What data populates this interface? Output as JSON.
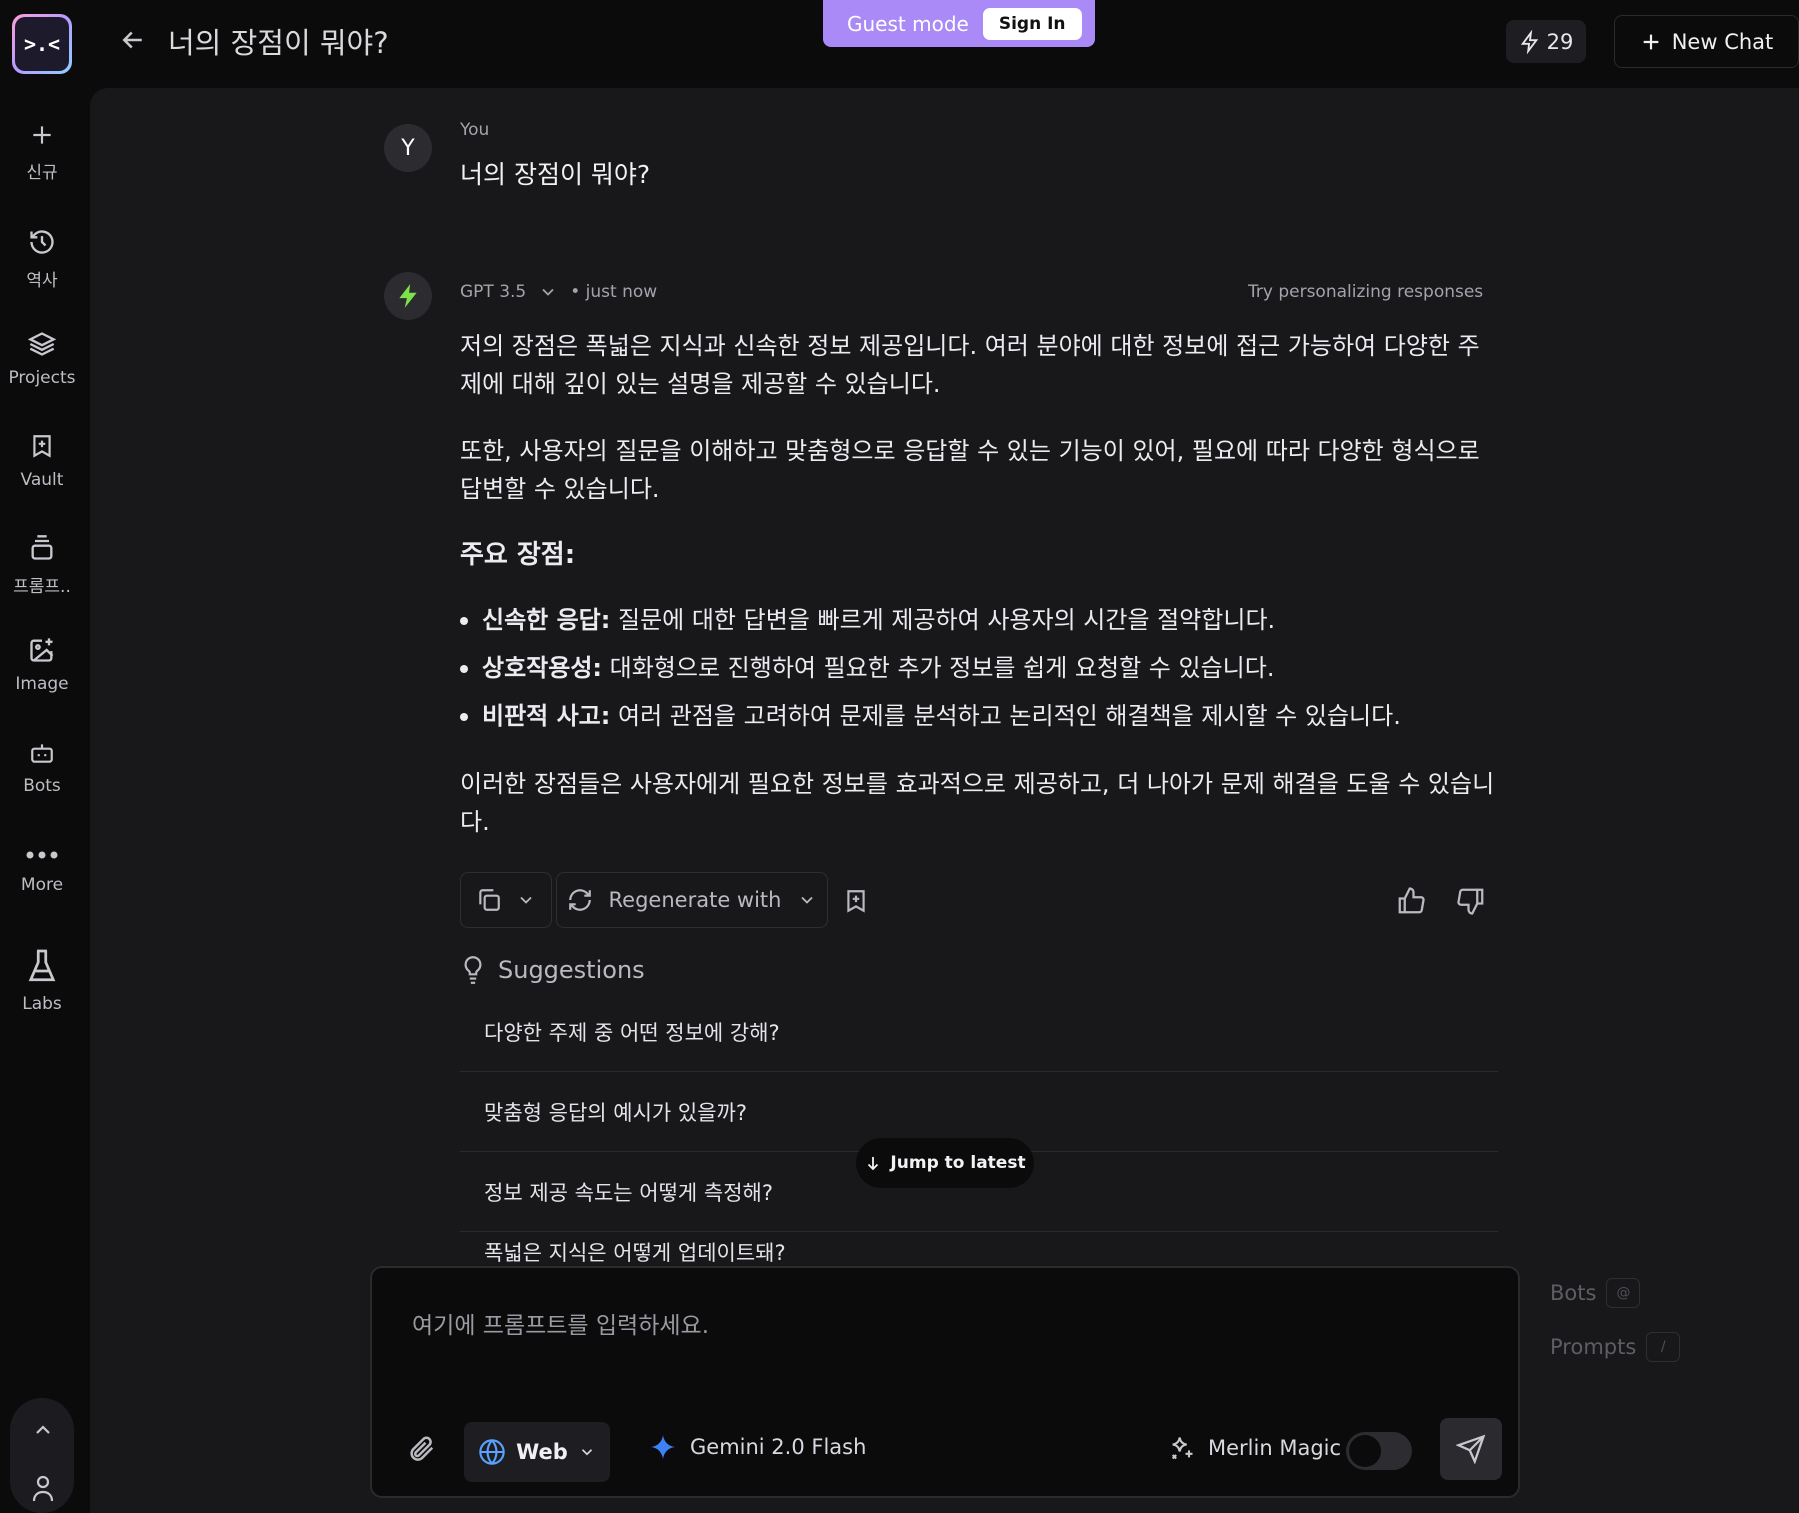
{
  "header": {
    "title": "너의 장점이 뭐야?",
    "guest_label": "Guest mode",
    "sign_in_label": "Sign In",
    "credits": "29",
    "new_chat_label": "New Chat"
  },
  "sidebar": {
    "logo_text": ">.<",
    "items": [
      {
        "label": "신규",
        "icon": "plus-icon"
      },
      {
        "label": "역사",
        "icon": "history-icon"
      },
      {
        "label": "Projects",
        "icon": "layers-icon"
      },
      {
        "label": "Vault",
        "icon": "vault-icon"
      },
      {
        "label": "프롬프..",
        "icon": "prompts-icon"
      },
      {
        "label": "Image",
        "icon": "image-plus-icon"
      },
      {
        "label": "Bots",
        "icon": "bot-icon"
      },
      {
        "label": "More",
        "icon": "more-icon"
      },
      {
        "label": "Labs",
        "icon": "flask-icon"
      }
    ]
  },
  "conversation": {
    "user": {
      "avatar_initial": "Y",
      "name": "You",
      "message": "너의 장점이 뭐야?"
    },
    "assistant": {
      "model": "GPT 3.5",
      "time": "• just now",
      "personalize": "Try personalizing responses",
      "paragraphs": [
        "저의 장점은 폭넓은 지식과 신속한 정보 제공입니다. 여러 분야에 대한 정보에 접근 가능하여 다양한 주제에 대해 깊이 있는 설명을 제공할 수 있습니다.",
        "또한, 사용자의 질문을 이해하고 맞춤형으로 응답할 수 있는 기능이 있어, 필요에 따라 다양한 형식으로 답변할 수 있습니다."
      ],
      "heading": "주요 장점:",
      "bullets": [
        {
          "term": "신속한 응답:",
          "text": " 질문에 대한 답변을 빠르게 제공하여 사용자의 시간을 절약합니다."
        },
        {
          "term": "상호작용성:",
          "text": " 대화형으로 진행하여 필요한 추가 정보를 쉽게 요청할 수 있습니다."
        },
        {
          "term": "비판적 사고:",
          "text": " 여러 관점을 고려하여 문제를 분석하고 논리적인 해결책을 제시할 수 있습니다."
        }
      ],
      "closing": "이러한 장점들은 사용자에게 필요한 정보를 효과적으로 제공하고, 더 나아가 문제 해결을 도울 수 있습니다."
    },
    "actions": {
      "regenerate_label": "Regenerate with"
    },
    "suggestions": {
      "title": "Suggestions",
      "items": [
        "다양한 주제 중 어떤 정보에 강해?",
        "맞춤형 응답의 예시가 있을까?",
        "정보 제공 속도는 어떻게 측정해?",
        "폭넓은 지식은 어떻게 업데이트돼?"
      ]
    },
    "jump_label": "Jump to latest"
  },
  "composer": {
    "placeholder": "여기에 프롬프트를 입력하세요.",
    "web_label": "Web",
    "model_label": "Gemini 2.0 Flash",
    "magic_label": "Merlin Magic",
    "magic_enabled": false
  },
  "shortcuts": [
    {
      "label": "Bots",
      "key": "@"
    },
    {
      "label": "Prompts",
      "key": "/"
    }
  ],
  "colors": {
    "accent": "#a98af6",
    "assistant_icon": "#7ee04a",
    "gemini_star": "#3b82f6"
  }
}
